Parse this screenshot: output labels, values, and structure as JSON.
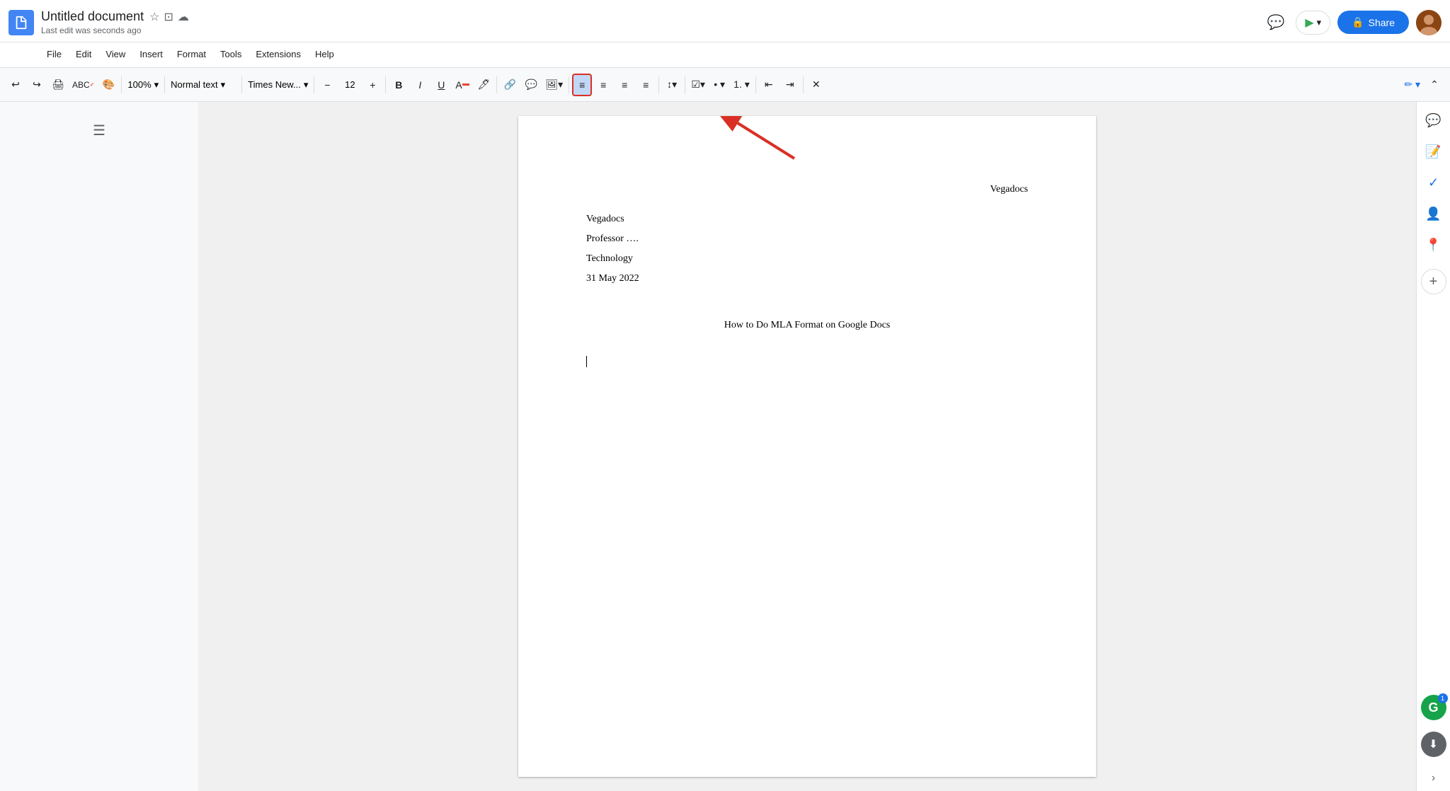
{
  "app": {
    "icon_label": "Google Docs icon",
    "title": "Untitled document",
    "last_edit": "Last edit was seconds ago"
  },
  "menu": {
    "items": [
      "File",
      "Edit",
      "View",
      "Insert",
      "Format",
      "Tools",
      "Extensions",
      "Help"
    ]
  },
  "toolbar": {
    "zoom": "100%",
    "style": "Normal text",
    "font": "Times New...",
    "font_size": "12",
    "undo_label": "Undo",
    "redo_label": "Redo",
    "print_label": "Print",
    "paint_label": "Paint format",
    "bold_label": "Bold",
    "italic_label": "Italic",
    "underline_label": "Underline",
    "text_color_label": "Text color",
    "highlight_label": "Highlight color",
    "link_label": "Insert link",
    "comment_label": "Insert comment",
    "image_label": "Insert image",
    "align_left_label": "Align left",
    "align_center_label": "Align center",
    "align_right_label": "Align right",
    "align_justify_label": "Justify",
    "line_spacing_label": "Line & paragraph spacing",
    "checklist_label": "Checklist",
    "bulleted_label": "Bulleted list",
    "numbered_label": "Numbered list",
    "decrease_indent_label": "Decrease indent",
    "increase_indent_label": "Increase indent",
    "clear_format_label": "Clear formatting",
    "pencil_label": "Editing",
    "collapse_label": "Collapse toolbar"
  },
  "share_btn": "Share",
  "document": {
    "header_name": "Vegadocs",
    "lines": [
      "Vegadocs",
      "Professor ….",
      "Technology",
      "31 May 2022"
    ],
    "title": "How to Do MLA Format on Google Docs"
  },
  "right_panel": {
    "chat_icon": "💬",
    "meet_icon": "📹",
    "tasks_icon": "✓",
    "contacts_icon": "👤",
    "maps_icon": "📍",
    "add_icon": "+",
    "grammarly_count": "1",
    "expand_icon": "›"
  }
}
